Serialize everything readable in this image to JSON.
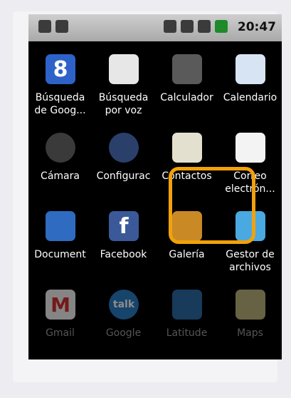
{
  "status": {
    "time": "20:47"
  },
  "apps": [
    [
      "Búsqueda\nde Goog...",
      "Búsqueda\npor voz",
      "Calculador",
      "Calendario"
    ],
    [
      "Cámara",
      "Configurac",
      "Contactos",
      "Correo\nelectrón..."
    ],
    [
      "Document",
      "Facebook",
      "Galería",
      "Gestor de\narchivos"
    ],
    [
      "Gmail",
      "Google",
      "Latitude",
      "Maps"
    ]
  ],
  "icons": [
    [
      "google-search-icon",
      "voice-search-icon",
      "calculator-icon",
      "calendar-icon"
    ],
    [
      "camera-icon",
      "settings-icon",
      "contacts-icon",
      "email-icon"
    ],
    [
      "documents-icon",
      "facebook-icon",
      "gallery-icon",
      "file-manager-icon"
    ],
    [
      "gmail-icon",
      "google-talk-icon",
      "latitude-icon",
      "maps-icon"
    ]
  ],
  "glyphs": {
    "google": "8",
    "facebook": "f",
    "talk": "talk",
    "gmail": "M"
  },
  "colors": {
    "highlight": "#f2a10a",
    "background": "#000000"
  }
}
